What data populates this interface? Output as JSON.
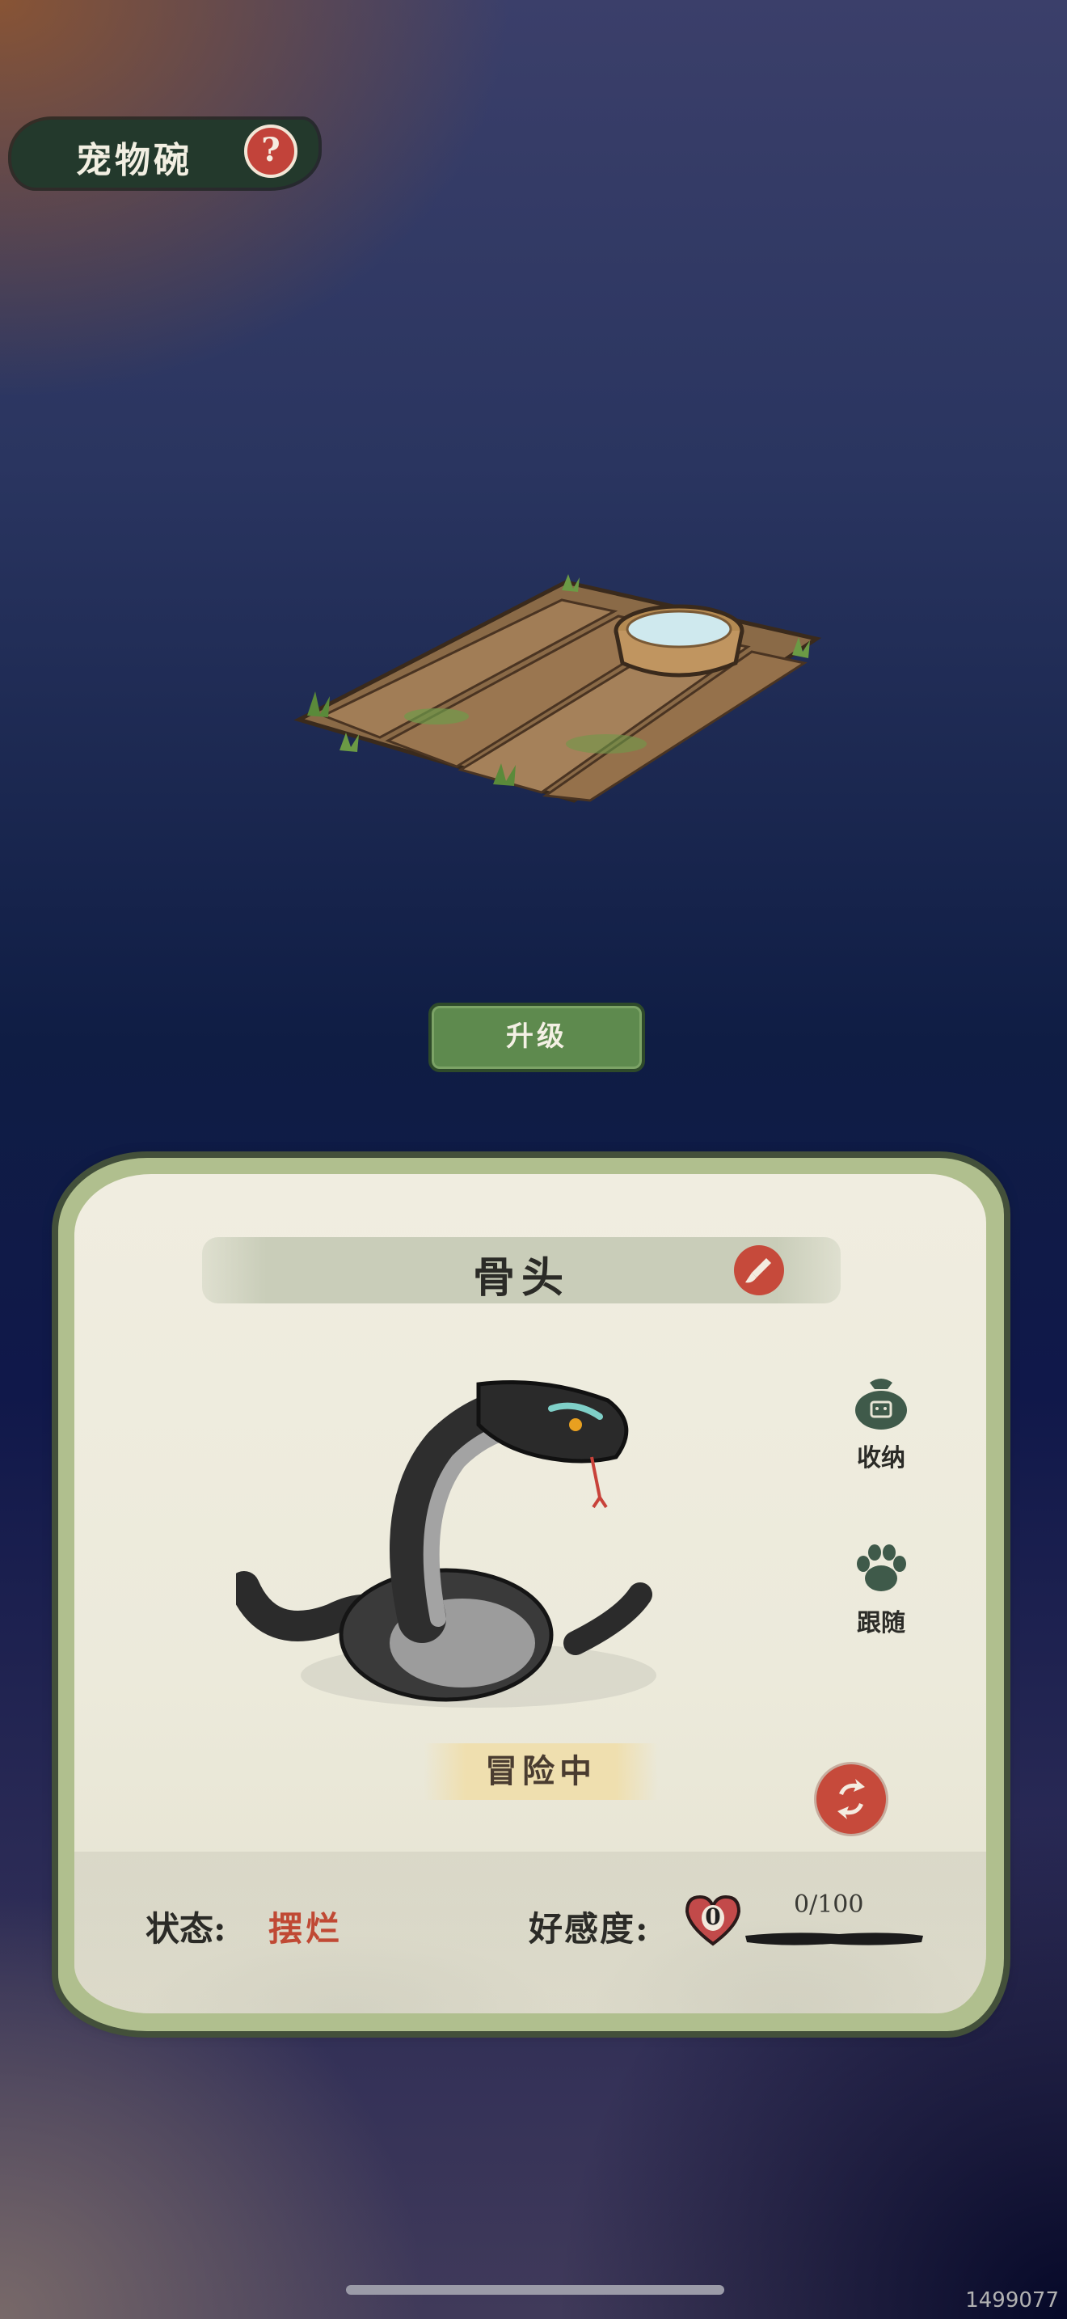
{
  "header": {
    "title": "宠物碗",
    "help_icon": "question-mark-icon"
  },
  "scene": {
    "object": "wooden-platform-with-water-bowl"
  },
  "upgrade_button": {
    "label": "升级"
  },
  "pet": {
    "name": "骨头",
    "edit_icon": "brush-icon",
    "state_tag": "冒险中",
    "actions": [
      {
        "label": "收纳",
        "icon": "storage-bag-icon"
      },
      {
        "label": "跟随",
        "icon": "paw-icon"
      }
    ],
    "refresh_icon": "refresh-icon",
    "status_label": "状态:",
    "status_value": "摆烂",
    "affinity_label": "好感度:",
    "affinity_level": "0",
    "affinity_progress": "0/100",
    "affinity_fraction": 0
  },
  "watermark": "1499077",
  "colors": {
    "accent_red": "#c64a3b",
    "green_button": "#5e8a4e",
    "panel_border": "#b0bf8e"
  }
}
